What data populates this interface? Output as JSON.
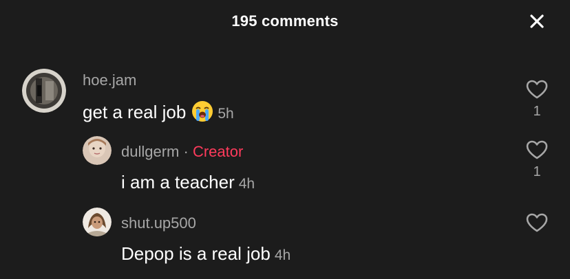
{
  "header": {
    "title": "195 comments",
    "close_icon": "close-icon"
  },
  "comments": [
    {
      "username": "hoe.jam",
      "text": "get a real job",
      "emoji": "loudly-crying-face-emoji",
      "time": "5h",
      "likes": "1"
    },
    {
      "username": "dullgerm",
      "separator": "·",
      "badge": "Creator",
      "text": "i am a teacher",
      "time": "4h",
      "likes": "1"
    },
    {
      "username": "shut.up500",
      "text": "Depop is a real job",
      "time": "4h",
      "likes": ""
    }
  ],
  "colors": {
    "background": "#1c1c1c",
    "muted_text": "#a7a7a7",
    "creator_accent": "#ff3b5c"
  },
  "icons": {
    "like": "heart-outline-icon"
  }
}
